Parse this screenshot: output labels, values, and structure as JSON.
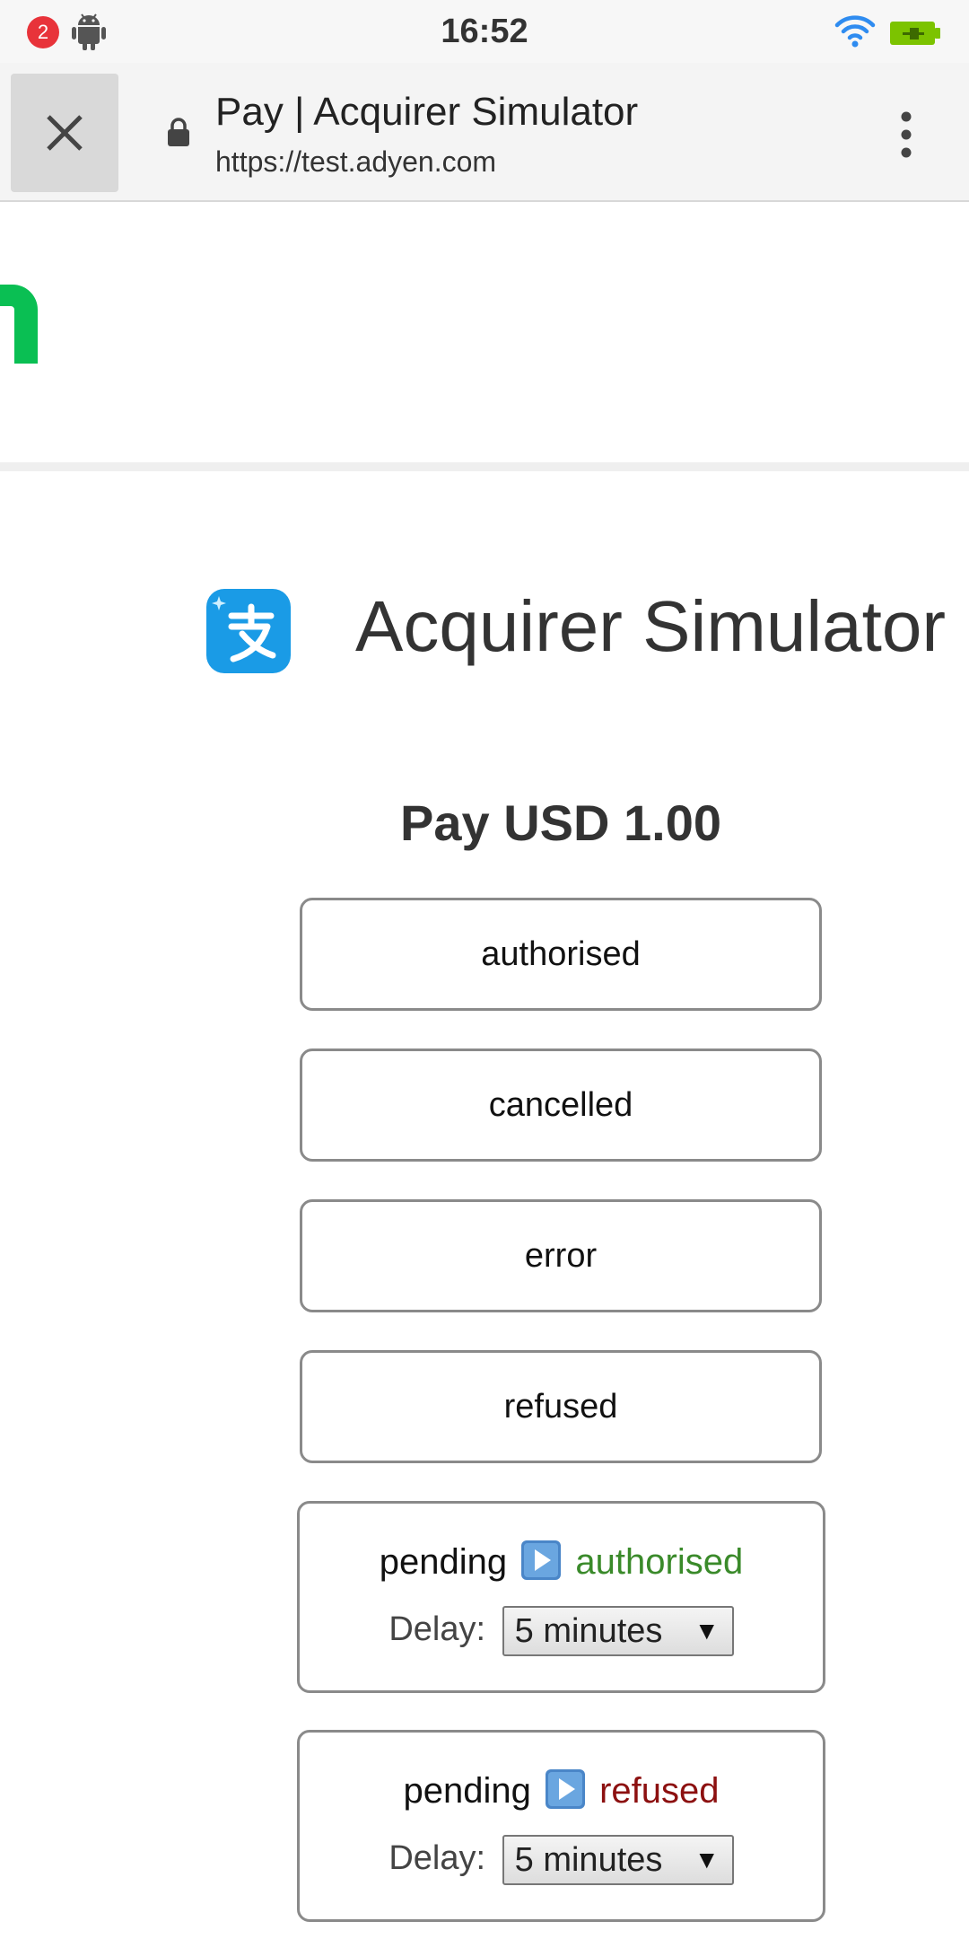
{
  "status_bar": {
    "notification_count": "2",
    "time": "16:52",
    "icons": [
      "android-icon",
      "wifi-icon",
      "battery-charging-icon"
    ],
    "wifi_color": "#2f8cf0",
    "battery_color": "#7cc300"
  },
  "browser": {
    "page_title": "Pay | Acquirer Simulator",
    "url": "https://test.adyen.com",
    "icons": [
      "close-icon",
      "lock-icon",
      "more-vert-icon"
    ]
  },
  "brand": {
    "logo_color": "#0abf53"
  },
  "acquirer": {
    "title": "Acquirer Simulator",
    "logo_color": "#1a9be6"
  },
  "payment": {
    "title": "Pay USD 1.00"
  },
  "buttons": [
    {
      "label": "authorised"
    },
    {
      "label": "cancelled"
    },
    {
      "label": "error"
    },
    {
      "label": "refused"
    }
  ],
  "pending_options": [
    {
      "prefix": "pending",
      "target": "authorised",
      "target_color": "#3a8a2a",
      "delay_label": "Delay:",
      "delay_value": "5 minutes"
    },
    {
      "prefix": "pending",
      "target": "refused",
      "target_color": "#8c1010",
      "delay_label": "Delay:",
      "delay_value": "5 minutes"
    }
  ]
}
